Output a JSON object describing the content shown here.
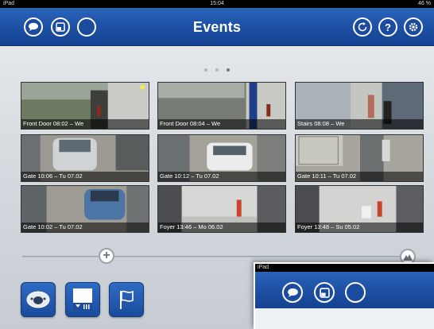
{
  "status_bar": {
    "carrier": "iPad",
    "clock": "15:04",
    "battery": "46 %"
  },
  "nav": {
    "title": "Events"
  },
  "page_dots": {
    "count": 3,
    "active": 2
  },
  "events": [
    {
      "caption": "Front Door 08:02 – We",
      "scene": "door"
    },
    {
      "caption": "Front Door 08:04 – We",
      "scene": "door2"
    },
    {
      "caption": "Stairs 08:08 – We",
      "scene": "stairs"
    },
    {
      "caption": "Gate 10:06 – Tu 07.02",
      "scene": "car"
    },
    {
      "caption": "Gate 10:12 – Tu 07.02",
      "scene": "car2"
    },
    {
      "caption": "Gate 10:11 – Tu 07.02",
      "scene": "gate"
    },
    {
      "caption": "Gate 10:02 – Tu 07.02",
      "scene": "car3"
    },
    {
      "caption": "Foyer 13:46 – Mo 06.02",
      "scene": "foyer"
    },
    {
      "caption": "Foyer 13:48 – Su 05.02",
      "scene": "foyer2"
    }
  ],
  "inset": {
    "carrier": "iPad"
  },
  "icons": {
    "chat": "chat-bubble-icon",
    "window": "window-icon",
    "compass": "compass-icon",
    "reload": "reload-icon",
    "help": "help-icon",
    "settings": "gear-icon",
    "camera": "dome-camera-icon",
    "event_list": "event-list-icon",
    "flag": "flag-icon",
    "add": "plus-icon",
    "mountain": "mountain-icon"
  },
  "colors": {
    "nav_blue": "#1c4fa2",
    "accent": "#2f6cc4"
  }
}
